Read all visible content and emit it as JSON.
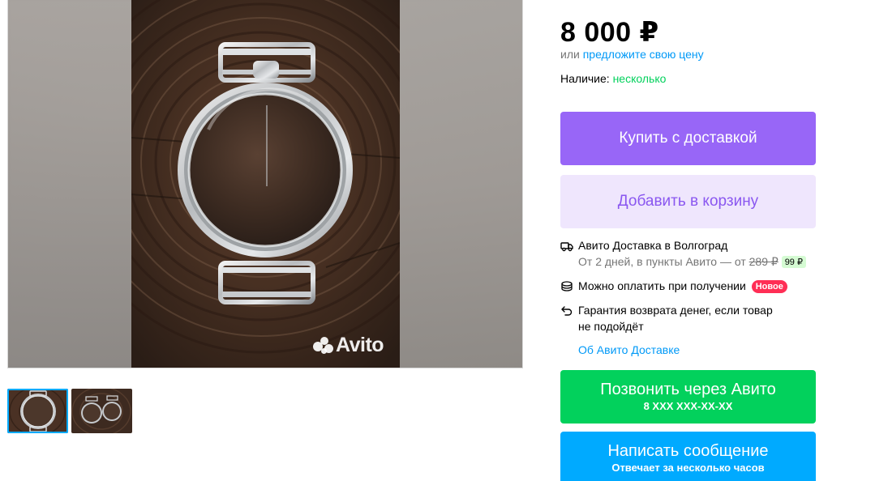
{
  "gallery": {
    "watermark": "Avito",
    "thumbnails": [
      {
        "name": "thumb-1",
        "active": true
      },
      {
        "name": "thumb-2",
        "active": false
      }
    ]
  },
  "price": {
    "value": "8 000 ₽",
    "offer_prefix": "или",
    "offer_link": "предложите свою цену"
  },
  "availability": {
    "label": "Наличие:",
    "value": "несколько"
  },
  "actions": {
    "buy_label": "Купить с доставкой",
    "cart_label": "Добавить в корзину"
  },
  "delivery": {
    "title": "Авито Доставка в Волгоград",
    "details_prefix": "От 2 дней, в пункты Авито — от",
    "old_price": "289 ₽",
    "new_price": "99 ₽",
    "pay_on_receipt": "Можно оплатить при получении",
    "new_badge": "Новое",
    "guarantee_line1": "Гарантия возврата денег, если товар",
    "guarantee_line2": "не подойдёт",
    "about_link": "Об Авито Доставке"
  },
  "contact": {
    "call_label": "Позвонить через Авито",
    "phone": "8 XXX XXX-XX-XX",
    "message_label": "Написать сообщение",
    "response_time": "Отвечает за несколько часов"
  },
  "colors": {
    "buy": "#9866f7",
    "cart_bg": "#efe6fd",
    "call": "#02d15c",
    "message": "#00aaff",
    "link": "#0099f7",
    "available": "#02d15c"
  }
}
